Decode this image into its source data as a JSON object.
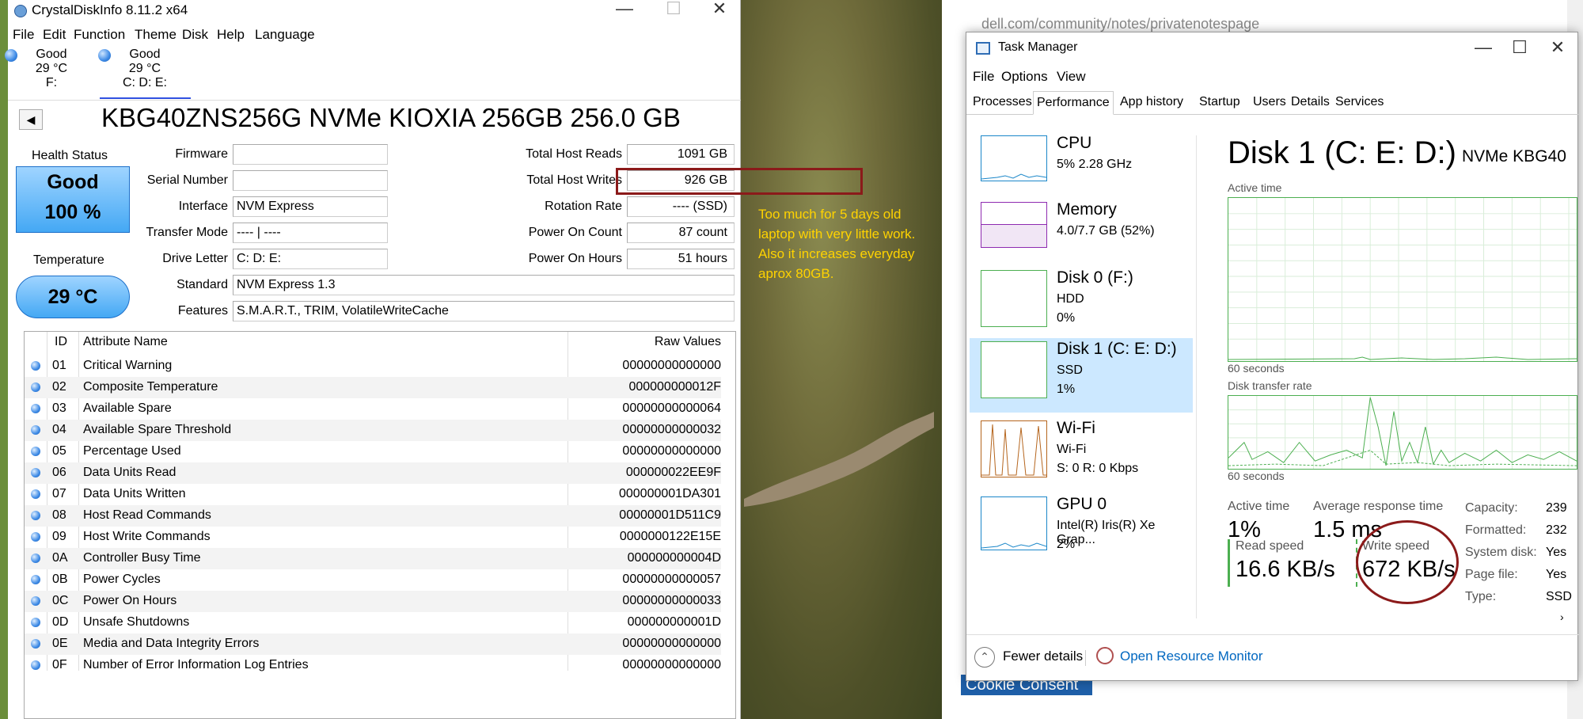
{
  "browser": {
    "url": "dell.com/community/notes/privatenotespage",
    "cookie_label": "Cookie Consent"
  },
  "cdi": {
    "title": "CrystalDiskInfo 8.11.2 x64",
    "menu": [
      "File",
      "Edit",
      "Function",
      "Theme",
      "Disk",
      "Help",
      "Language"
    ],
    "disks": [
      {
        "status": "Good",
        "temp": "29 °C",
        "letter": "F:"
      },
      {
        "status": "Good",
        "temp": "29 °C",
        "letter": "C: D: E:"
      }
    ],
    "model": "KBG40ZNS256G NVMe KIOXIA 256GB 256.0 GB",
    "health_label": "Health Status",
    "health_status": "Good",
    "health_pct": "100 %",
    "temp_label": "Temperature",
    "temp_value": "29 °C",
    "firmware_label": "Firmware",
    "firmware": "",
    "serial_label": "Serial Number",
    "serial": "",
    "interface_label": "Interface",
    "interface": "NVM Express",
    "transfer_label": "Transfer Mode",
    "transfer": "---- | ----",
    "drive_letter_label": "Drive Letter",
    "drive_letter": "C: D: E:",
    "standard_label": "Standard",
    "standard": "NVM Express 1.3",
    "features_label": "Features",
    "features": "S.M.A.R.T., TRIM, VolatileWriteCache",
    "reads_label": "Total Host Reads",
    "reads": "1091 GB",
    "writes_label": "Total Host Writes",
    "writes": "926 GB",
    "rotation_label": "Rotation Rate",
    "rotation": "---- (SSD)",
    "power_count_label": "Power On Count",
    "power_count": "87 count",
    "power_hours_label": "Power On Hours",
    "power_hours": "51 hours",
    "annotation": "Too much for 5 days old laptop with very little work. Also it increases everyday aprox 80GB.",
    "smart_headers": {
      "id": "ID",
      "name": "Attribute Name",
      "raw": "Raw Values"
    },
    "smart_rows": [
      {
        "id": "01",
        "name": "Critical Warning",
        "raw": "00000000000000"
      },
      {
        "id": "02",
        "name": "Composite Temperature",
        "raw": "000000000012F"
      },
      {
        "id": "03",
        "name": "Available Spare",
        "raw": "00000000000064"
      },
      {
        "id": "04",
        "name": "Available Spare Threshold",
        "raw": "00000000000032"
      },
      {
        "id": "05",
        "name": "Percentage Used",
        "raw": "00000000000000"
      },
      {
        "id": "06",
        "name": "Data Units Read",
        "raw": "000000022EE9F"
      },
      {
        "id": "07",
        "name": "Data Units Written",
        "raw": "000000001DA301"
      },
      {
        "id": "08",
        "name": "Host Read Commands",
        "raw": "00000001D511C9"
      },
      {
        "id": "09",
        "name": "Host Write Commands",
        "raw": "0000000122E15E"
      },
      {
        "id": "0A",
        "name": "Controller Busy Time",
        "raw": "000000000004D"
      },
      {
        "id": "0B",
        "name": "Power Cycles",
        "raw": "00000000000057"
      },
      {
        "id": "0C",
        "name": "Power On Hours",
        "raw": "00000000000033"
      },
      {
        "id": "0D",
        "name": "Unsafe Shutdowns",
        "raw": "000000000001D"
      },
      {
        "id": "0E",
        "name": "Media and Data Integrity Errors",
        "raw": "00000000000000"
      },
      {
        "id": "0F",
        "name": "Number of Error Information Log Entries",
        "raw": "00000000000000"
      }
    ]
  },
  "tm": {
    "title": "Task Manager",
    "menu": [
      "File",
      "Options",
      "View"
    ],
    "tabs": [
      "Processes",
      "Performance",
      "App history",
      "Startup",
      "Users",
      "Details",
      "Services"
    ],
    "active_tab": "Performance",
    "side": [
      {
        "name": "CPU",
        "sub1": "5%  2.28 GHz",
        "sub2": "",
        "color": "#1b87c9"
      },
      {
        "name": "Memory",
        "sub1": "4.0/7.7 GB (52%)",
        "sub2": "",
        "color": "#8e2bb0"
      },
      {
        "name": "Disk 0 (F:)",
        "sub1": "HDD",
        "sub2": "0%",
        "color": "#4caf50"
      },
      {
        "name": "Disk 1 (C: E: D:)",
        "sub1": "SSD",
        "sub2": "1%",
        "color": "#4caf50"
      },
      {
        "name": "Wi-Fi",
        "sub1": "Wi-Fi",
        "sub2": "S: 0  R: 0 Kbps",
        "color": "#b5651d"
      },
      {
        "name": "GPU 0",
        "sub1": "Intel(R) Iris(R) Xe Grap...",
        "sub2": "2%",
        "color": "#1b87c9"
      }
    ],
    "disk_title": "Disk 1 (C: E: D:)",
    "disk_model": "NVMe KBG40",
    "active_time_caption": "Active time",
    "sixty": "60 seconds",
    "transfer_caption": "Disk transfer rate",
    "active_time_label": "Active time",
    "active_time_value": "1%",
    "avg_resp_label": "Average response time",
    "avg_resp_value": "1.5 ms",
    "read_label": "Read speed",
    "read_value": "16.6 KB/s",
    "write_label": "Write speed",
    "write_value": "672 KB/s",
    "kv": [
      {
        "k": "Capacity:",
        "v": "239"
      },
      {
        "k": "Formatted:",
        "v": "232"
      },
      {
        "k": "System disk:",
        "v": "Yes"
      },
      {
        "k": "Page file:",
        "v": "Yes"
      },
      {
        "k": "Type:",
        "v": "SSD"
      }
    ],
    "fewer_details": "Fewer details",
    "open_resource_monitor": "Open Resource Monitor"
  }
}
